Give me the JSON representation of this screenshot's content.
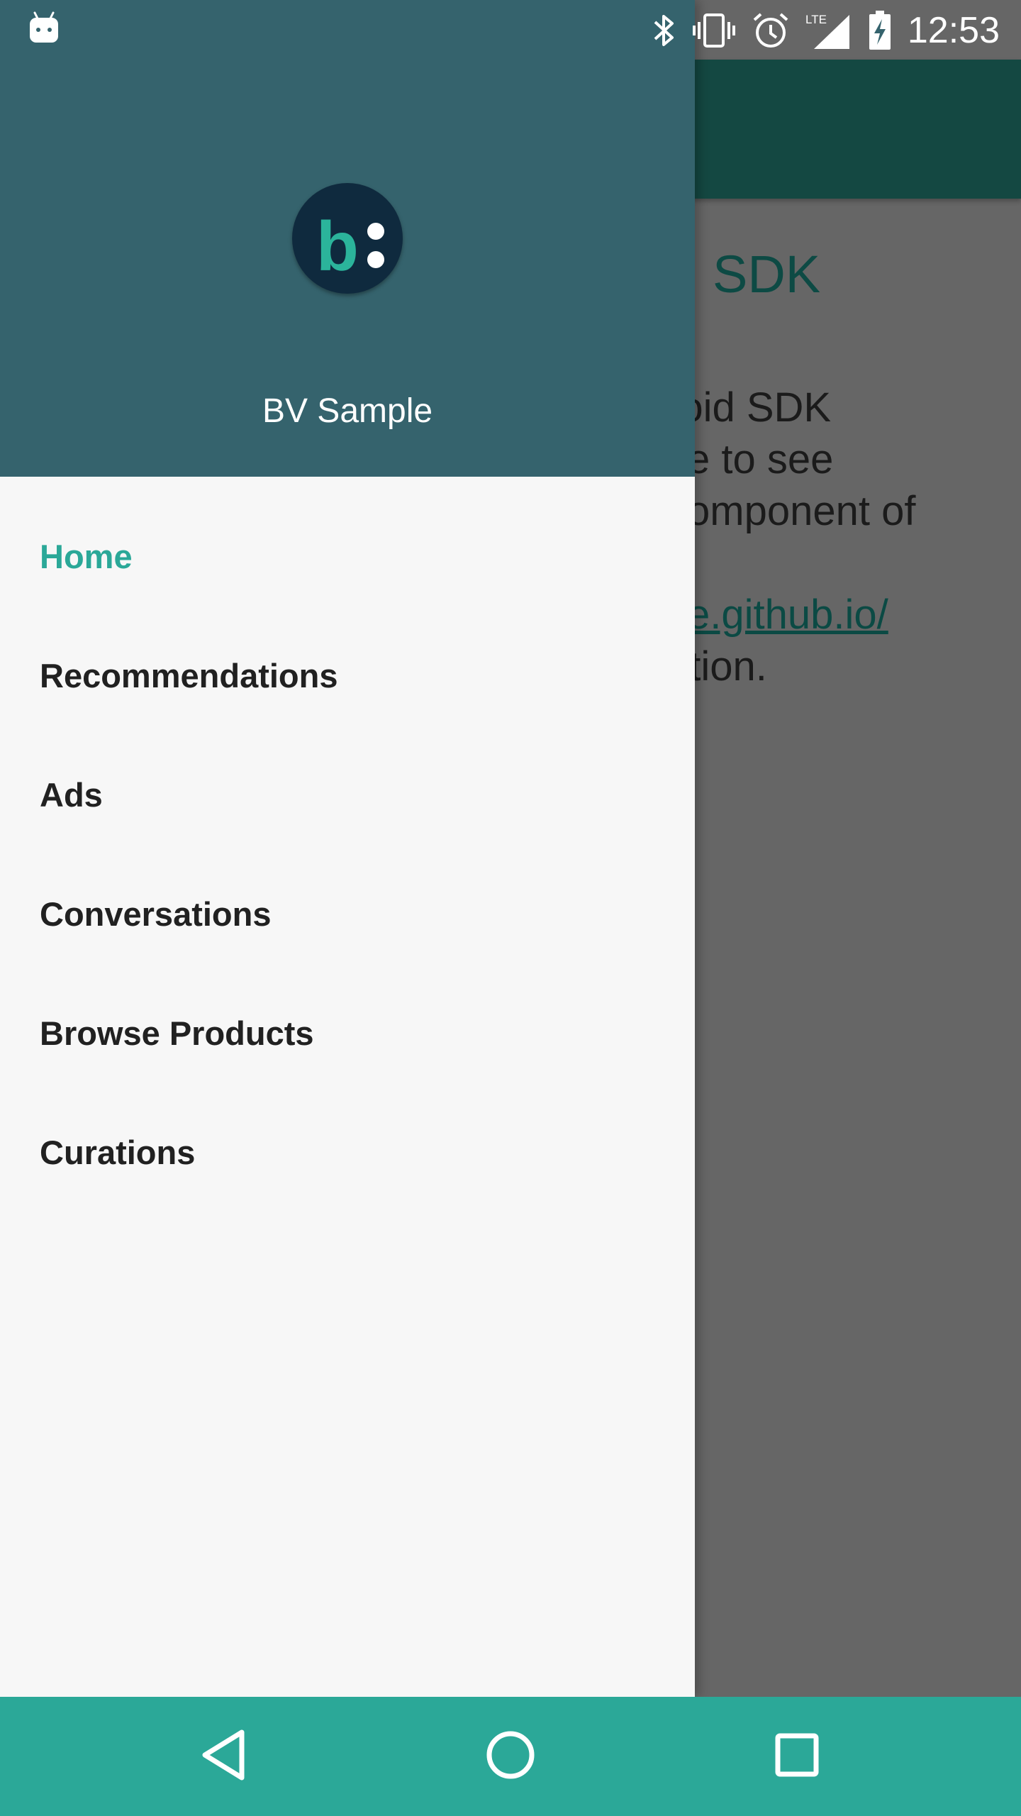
{
  "status_bar": {
    "time": "12:53",
    "icons": [
      "android-icon",
      "bluetooth-icon",
      "vibrate-icon",
      "alarm-icon",
      "lte-signal-icon",
      "battery-charging-icon"
    ],
    "network_label": "LTE"
  },
  "app": {
    "heading": "l SDK",
    "body_lines": [
      "roid SDK",
      "ve to see",
      "component of",
      "",
      "ce.github.io/",
      "ation."
    ]
  },
  "drawer": {
    "header": {
      "logo": "bv-logo",
      "logo_letter": "b",
      "title": "BV Sample"
    },
    "items": [
      {
        "label": "Home",
        "active": true
      },
      {
        "label": "Recommendations",
        "active": false
      },
      {
        "label": "Ads",
        "active": false
      },
      {
        "label": "Conversations",
        "active": false
      },
      {
        "label": "Browse Products",
        "active": false
      },
      {
        "label": "Curations",
        "active": false
      }
    ]
  },
  "nav_bar": {
    "buttons": [
      "back-icon",
      "home-icon",
      "recents-icon"
    ]
  },
  "colors": {
    "drawer_header": "#35636d",
    "accent": "#2ba898",
    "app_bar": "#144842",
    "scrim": "#666666"
  }
}
